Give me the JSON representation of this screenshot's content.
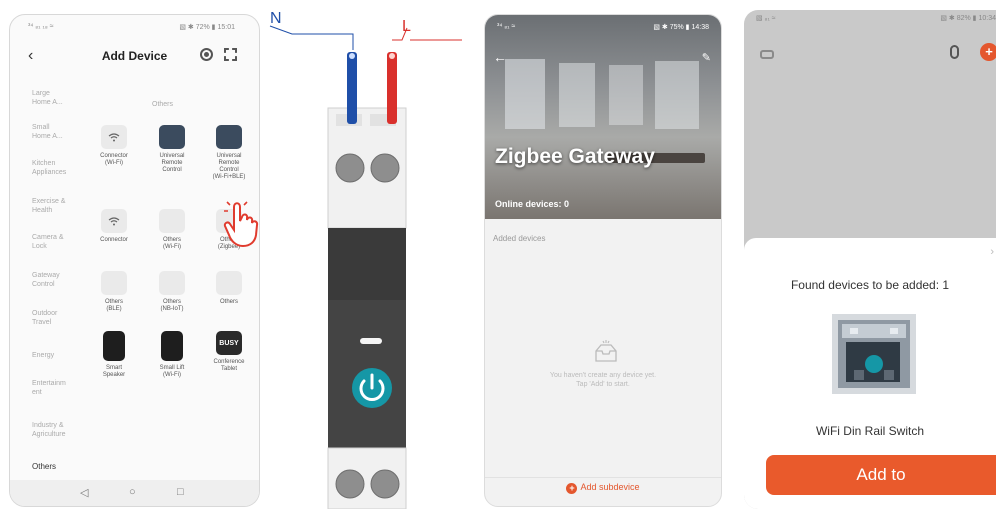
{
  "screen1": {
    "status_left": "³⁴ ₈₁ ₁₈ ≈",
    "status_right": "▧ ✱ 72% ▮ 15:01",
    "back_icon": "chevron-left-icon",
    "title": "Add Device",
    "categories": [
      {
        "label": "Large\nHome A..."
      },
      {
        "label": "Small\nHome A..."
      },
      {
        "label": "Kitchen\nAppliances"
      },
      {
        "label": "Exercise &\nHealth"
      },
      {
        "label": "Camera &\nLock"
      },
      {
        "label": "Gateway\nControl"
      },
      {
        "label": "Outdoor\nTravel"
      },
      {
        "label": "Energy"
      },
      {
        "label": "Entertainm\nent"
      },
      {
        "label": "Industry &\nAgriculture"
      },
      {
        "label": "Others"
      }
    ],
    "section_title": "Others",
    "devices": [
      {
        "label": "Connector\n(Wi-Fi)"
      },
      {
        "label": "Universal\nRemote\nControl"
      },
      {
        "label": "Universal\nRemote\nControl\n(Wi-Fi+BLE)"
      },
      {
        "label": "Connector"
      },
      {
        "label": "Others\n(Wi-Fi)"
      },
      {
        "label": "Others\n(Zigbee)"
      },
      {
        "label": "Others\n(BLE)"
      },
      {
        "label": "Others\n(NB-IoT)"
      },
      {
        "label": "Others"
      },
      {
        "label": "Smart\nSpeaker"
      },
      {
        "label": "Small Lift\n(Wi-Fi)"
      },
      {
        "label": "Conference\nTablet",
        "badge": "BUSY"
      }
    ],
    "nav": [
      "◁",
      "○",
      "□"
    ]
  },
  "wiring": {
    "neutral_label": "N",
    "live_label": "L",
    "neutral_color": "#1f4fa8",
    "live_color": "#d9302c",
    "power_color": "#1597a6"
  },
  "screen3": {
    "status_left": "³⁴ ₈₁ ≈",
    "status_right": "▧ ✱ 75% ▮ 14:38",
    "title": "Zigbee Gateway",
    "online": "Online devices: 0",
    "added_label": "Added devices",
    "empty_text_1": "You haven't create any device yet.",
    "empty_text_2": "Tap 'Add' to start.",
    "add_subdevice": "Add subdevice",
    "accent": "#e4572e"
  },
  "screen4": {
    "status_left": "▧ ₈₁ ≈",
    "status_right": "▧ ✱ 82% ▮ 10:34",
    "found_text": "Found devices to be added: 1",
    "device_name": "WiFi Din Rail Switch",
    "add_button": "Add to",
    "close_icon": "›",
    "accent": "#e95a2c"
  }
}
